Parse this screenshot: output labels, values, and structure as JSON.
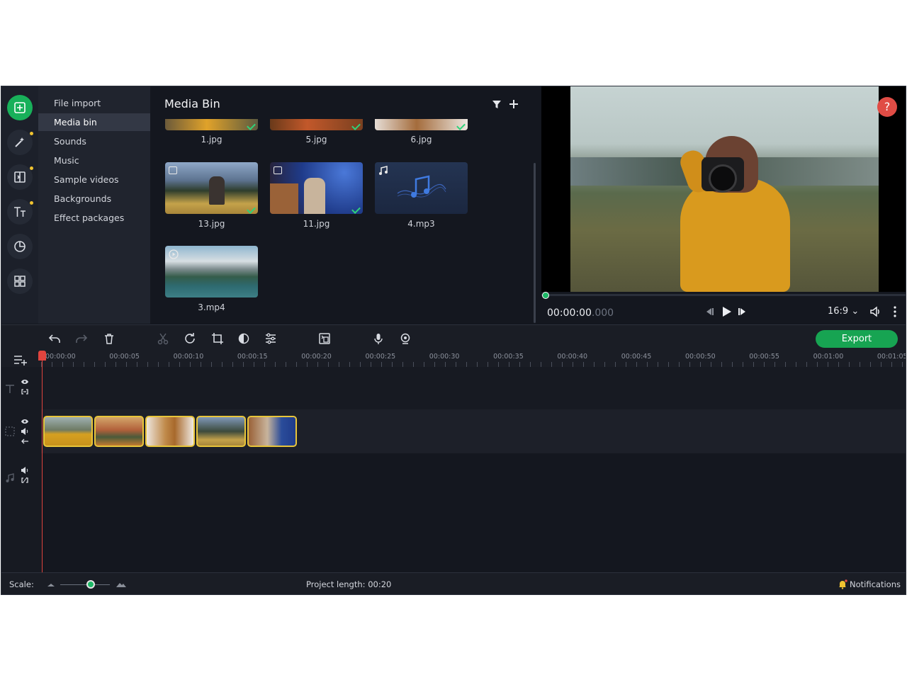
{
  "sidebar": {
    "categories": [
      "File import",
      "Media bin",
      "Sounds",
      "Music",
      "Sample videos",
      "Backgrounds",
      "Effect packages"
    ],
    "active": "Media bin"
  },
  "media_bin": {
    "title": "Media Bin",
    "items": [
      {
        "name": "1.jpg",
        "kind": "image"
      },
      {
        "name": "5.jpg",
        "kind": "image"
      },
      {
        "name": "6.jpg",
        "kind": "image"
      },
      {
        "name": "13.jpg",
        "kind": "image"
      },
      {
        "name": "11.jpg",
        "kind": "image"
      },
      {
        "name": "4.mp3",
        "kind": "audio"
      },
      {
        "name": "3.mp4",
        "kind": "video"
      }
    ]
  },
  "player": {
    "timecode": "00:00:00",
    "timecode_ms": ".000",
    "aspect_ratio": "16:9",
    "help_label": "?"
  },
  "toolbar": {
    "export_label": "Export"
  },
  "ruler": {
    "labels": [
      "00:00:00",
      "00:00:05",
      "00:00:10",
      "00:00:15",
      "00:00:20",
      "00:00:25",
      "00:00:30",
      "00:00:35",
      "00:00:40",
      "00:00:45",
      "00:00:50",
      "00:00:55",
      "00:01:00",
      "00:01:05"
    ]
  },
  "status": {
    "scale_label": "Scale:",
    "project_length": "Project length:  00:20",
    "notifications": "Notifications"
  },
  "colors": {
    "accent": "#18b05a",
    "export": "#17a452",
    "clip_border": "#e8c53a",
    "playhead": "#e0443e",
    "help": "#e04c45"
  }
}
